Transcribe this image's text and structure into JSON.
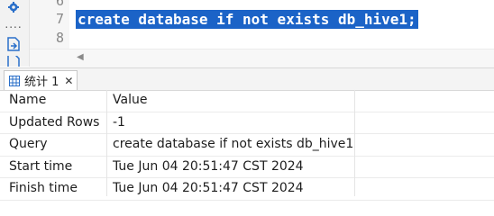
{
  "editor": {
    "line_numbers": [
      "6",
      "7",
      "8"
    ],
    "code_line": "create database if not exists db_hive1;"
  },
  "toolbar": {
    "icons": [
      "gear-icon",
      "more-icon",
      "export-icon",
      "export2-icon"
    ],
    "more_label": "...."
  },
  "result_tab": {
    "label": "统计 1",
    "close": "✕"
  },
  "stats": {
    "header": {
      "name": "Name",
      "value": "Value"
    },
    "rows": [
      {
        "name": "Updated Rows",
        "value": "-1"
      },
      {
        "name": "Query",
        "value": "create database if not exists db_hive1"
      },
      {
        "name": "Start time",
        "value": "Tue Jun 04 20:51:47 CST 2024"
      },
      {
        "name": "Finish time",
        "value": "Tue Jun 04 20:51:47 CST 2024"
      }
    ]
  },
  "colors": {
    "selection": "#1b63c7",
    "accent_icon": "#2a6fc9"
  }
}
